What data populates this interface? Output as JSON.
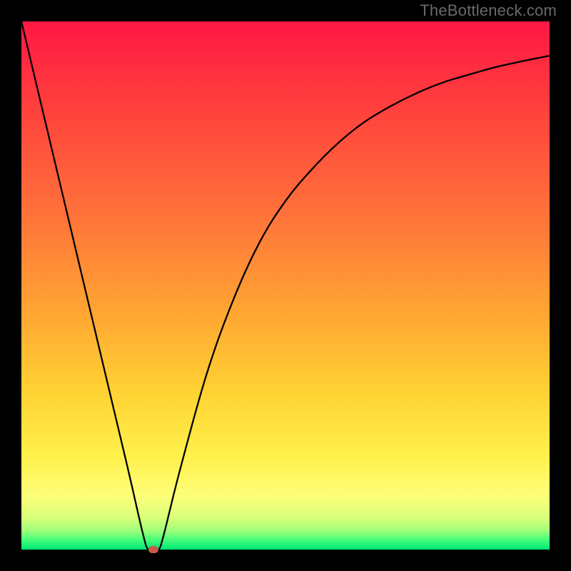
{
  "watermark": "TheBottleneck.com",
  "chart_data": {
    "type": "line",
    "title": "",
    "xlabel": "",
    "ylabel": "",
    "xlim": [
      0,
      100
    ],
    "ylim": [
      0,
      100
    ],
    "grid": false,
    "background": "rainbow-gradient",
    "series": [
      {
        "name": "bottleneck-curve",
        "x": [
          0,
          5,
          10,
          15,
          20,
          23,
          24,
          25,
          26,
          27,
          30,
          35,
          40,
          45,
          50,
          55,
          60,
          65,
          70,
          75,
          80,
          85,
          90,
          95,
          100
        ],
        "y": [
          100,
          79,
          58,
          37,
          16,
          3,
          0,
          0,
          0,
          3,
          15,
          33,
          47,
          58,
          66,
          72,
          77,
          81,
          84,
          86.5,
          88.5,
          90,
          91.4,
          92.5,
          93.5
        ],
        "color": "#000000"
      }
    ],
    "marker": {
      "x": 25,
      "y": 0,
      "color": "#c85a4a"
    },
    "gradient_stops": [
      {
        "pos": 0,
        "color": "#ff1744"
      },
      {
        "pos": 15,
        "color": "#ff3d3d"
      },
      {
        "pos": 35,
        "color": "#ff6e3a"
      },
      {
        "pos": 55,
        "color": "#ffa533"
      },
      {
        "pos": 70,
        "color": "#ffd233"
      },
      {
        "pos": 82,
        "color": "#fff04a"
      },
      {
        "pos": 90,
        "color": "#fdff7a"
      },
      {
        "pos": 94,
        "color": "#d8ff7a"
      },
      {
        "pos": 96.5,
        "color": "#9cff7a"
      },
      {
        "pos": 98,
        "color": "#4dff7a"
      },
      {
        "pos": 100,
        "color": "#00e676"
      }
    ]
  }
}
